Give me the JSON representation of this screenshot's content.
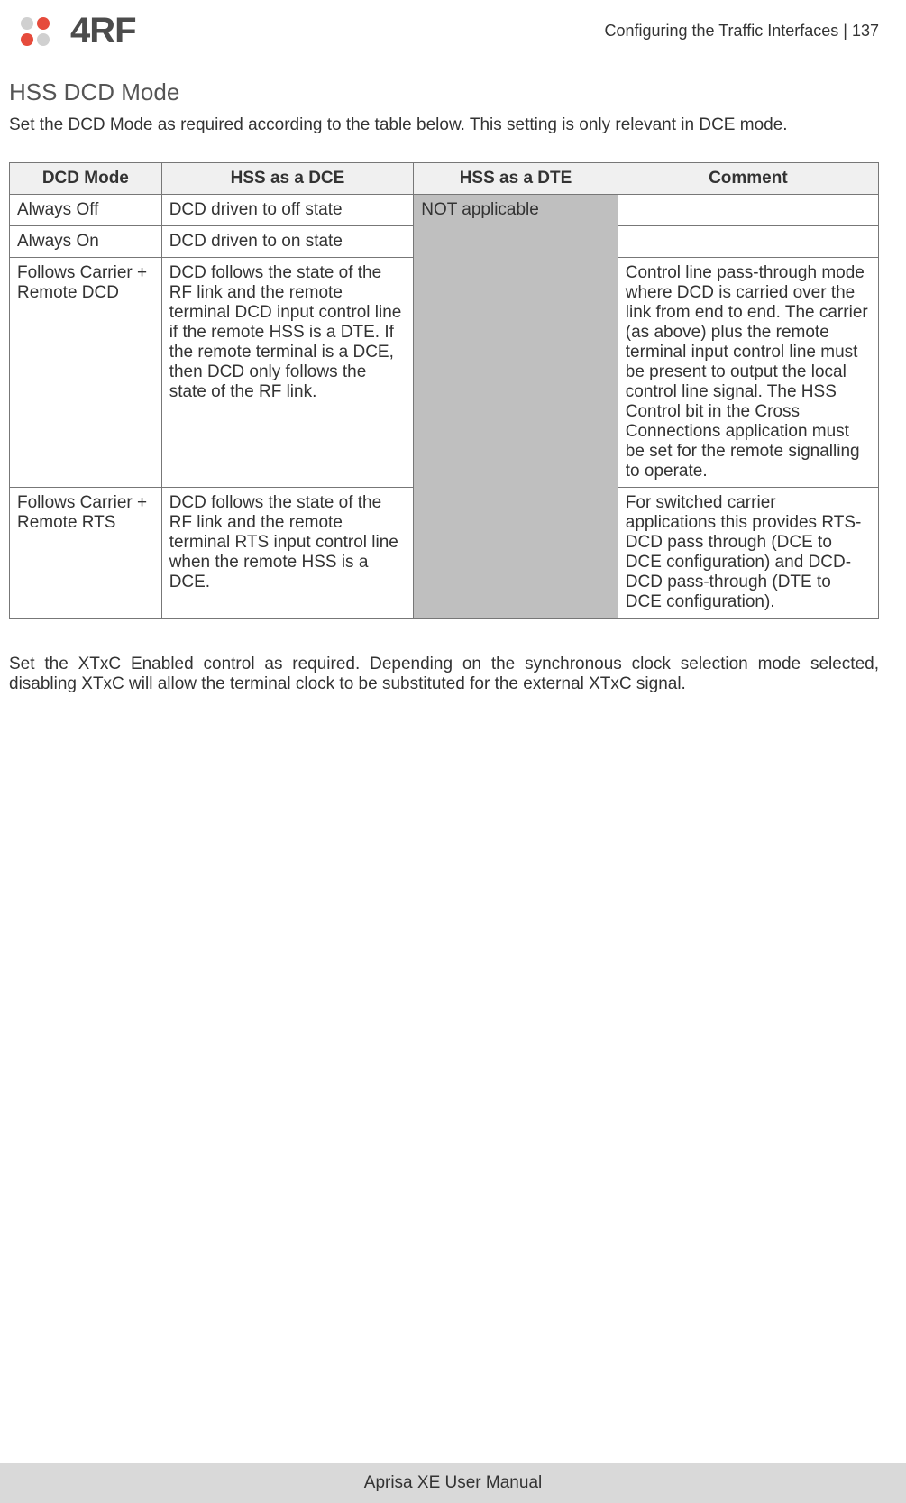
{
  "header": {
    "breadcrumb_section": "Configuring the Traffic Interfaces",
    "breadcrumb_sep": "  |  ",
    "page_number": "137",
    "logo_text": "4RF"
  },
  "section": {
    "title": "HSS DCD Mode",
    "intro": "Set the DCD Mode as required according to the table below. This setting is only relevant in DCE mode.",
    "after_table": "Set the XTxC Enabled control as required. Depending on the synchronous clock selection mode selected, disabling XTxC will allow the terminal clock to be substituted for the external XTxC signal."
  },
  "table": {
    "headers": [
      "DCD Mode",
      "HSS as a DCE",
      "HSS as a DTE",
      "Comment"
    ],
    "dte_span_text": "NOT applicable",
    "rows": [
      {
        "mode": "Always Off",
        "dce": "DCD driven to off state",
        "comment": ""
      },
      {
        "mode": "Always On",
        "dce": "DCD driven to on state",
        "comment": ""
      },
      {
        "mode": "Follows Carrier + Remote DCD",
        "dce": "DCD follows the state of the RF link and the remote terminal DCD input control line if the remote HSS is a DTE. If the remote terminal is a DCE, then DCD only follows the state of the RF link.",
        "comment": "Control line pass-through mode where DCD is carried over the link from end to end. The carrier (as above) plus the remote terminal input control line must be present to output the local control line signal. The HSS Control bit in the Cross Connections application must be set for the remote signalling to operate."
      },
      {
        "mode": "Follows Carrier + Remote RTS",
        "dce": "DCD follows the state of the RF link and the remote terminal RTS input control line when the remote HSS is a DCE.",
        "comment": "For switched carrier applications this provides RTS-DCD pass through (DCE to DCE configuration) and DCD-DCD pass-through (DTE to DCE configuration)."
      }
    ]
  },
  "footer": {
    "text": "Aprisa XE User Manual"
  }
}
